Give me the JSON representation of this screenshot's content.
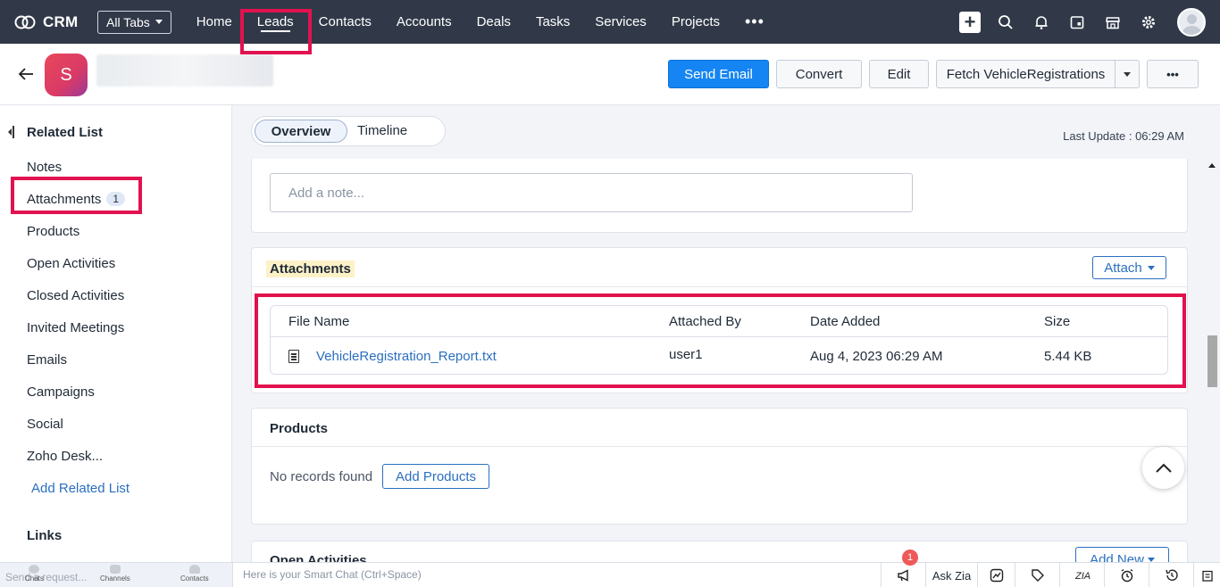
{
  "app": {
    "name": "CRM"
  },
  "topnav": {
    "all_tabs": "All Tabs",
    "items": [
      "Home",
      "Leads",
      "Contacts",
      "Accounts",
      "Deals",
      "Tasks",
      "Services",
      "Projects"
    ],
    "more": "•••",
    "active": "Leads",
    "icons": [
      "add-icon",
      "search-icon",
      "bell-icon",
      "calendar-icon",
      "store-icon",
      "gear-icon",
      "user-avatar"
    ]
  },
  "record": {
    "avatar_letter": "S",
    "buttons": {
      "send_email": "Send Email",
      "convert": "Convert",
      "edit": "Edit",
      "fetch": "Fetch VehicleRegistrations",
      "more": "•••"
    }
  },
  "sidebar": {
    "title": "Related List",
    "items": [
      {
        "label": "Notes"
      },
      {
        "label": "Attachments",
        "badge": "1"
      },
      {
        "label": "Products"
      },
      {
        "label": "Open Activities"
      },
      {
        "label": "Closed Activities"
      },
      {
        "label": "Invited Meetings"
      },
      {
        "label": "Emails"
      },
      {
        "label": "Campaigns"
      },
      {
        "label": "Social"
      },
      {
        "label": "Zoho Desk..."
      }
    ],
    "add_related": "Add Related List",
    "links_title": "Links"
  },
  "main": {
    "tabs": {
      "overview": "Overview",
      "timeline": "Timeline"
    },
    "last_update": "Last Update : 06:29 AM",
    "notes": {
      "placeholder": "Add a note..."
    },
    "attachments": {
      "title": "Attachments",
      "attach_button": "Attach",
      "columns": [
        "File Name",
        "Attached By",
        "Date Added",
        "Size"
      ],
      "rows": [
        {
          "file_name": "VehicleRegistration_Report.txt",
          "attached_by": "user1",
          "date_added": "Aug 4, 2023 06:29 AM",
          "size": "5.44 KB"
        }
      ]
    },
    "products": {
      "title": "Products",
      "empty": "No records found",
      "add_button": "Add Products"
    },
    "open_activities": {
      "title": "Open Activities",
      "add_button": "Add New"
    }
  },
  "bottombar": {
    "request_text": "Send a request...",
    "chats": "Chats",
    "channels": "Channels",
    "contacts": "Contacts",
    "smart_chat": "Here is your Smart Chat (Ctrl+Space)",
    "notif_count": "1",
    "ask_zia": "Ask Zia"
  },
  "colors": {
    "nav_bg": "#313949",
    "primary": "#1585f3",
    "highlight": "#e2124f",
    "link": "#2a6fbf"
  }
}
